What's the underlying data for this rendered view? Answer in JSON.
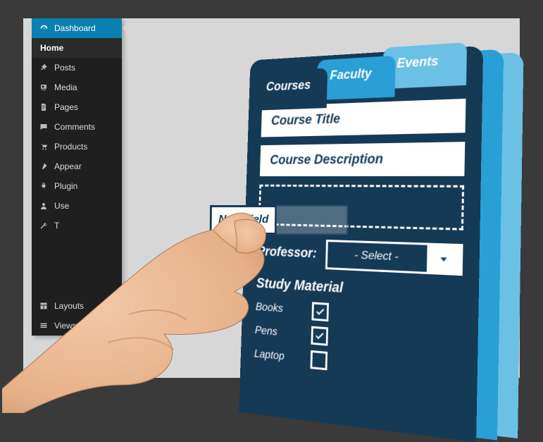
{
  "sidebar": {
    "items": [
      {
        "label": "Dashboard",
        "icon": "gauge"
      },
      {
        "label": "Home",
        "icon": ""
      },
      {
        "label": "Posts",
        "icon": "pin"
      },
      {
        "label": "Media",
        "icon": "media"
      },
      {
        "label": "Pages",
        "icon": "page"
      },
      {
        "label": "Comments",
        "icon": "comment"
      },
      {
        "label": "Products",
        "icon": "cart"
      },
      {
        "label": "Appear",
        "icon": "brush"
      },
      {
        "label": "Plugin",
        "icon": "plug"
      },
      {
        "label": "Use",
        "icon": "user"
      },
      {
        "label": "T",
        "icon": "wrench"
      },
      {
        "label": "Layouts",
        "icon": "layout"
      },
      {
        "label": "Views",
        "icon": "views"
      }
    ]
  },
  "tabs": [
    {
      "label": "Courses"
    },
    {
      "label": "Faculty"
    },
    {
      "label": "Events"
    }
  ],
  "form": {
    "fields": [
      {
        "label": "Course Title"
      },
      {
        "label": "Course Description"
      }
    ],
    "new_field_label": "New Field",
    "professor_label": "Professor:",
    "select_placeholder": "- Select -",
    "study_material_title": "Study Material",
    "study_items": [
      {
        "label": "Books",
        "checked": true
      },
      {
        "label": "Pens",
        "checked": true
      },
      {
        "label": "Laptop",
        "checked": false
      }
    ]
  }
}
